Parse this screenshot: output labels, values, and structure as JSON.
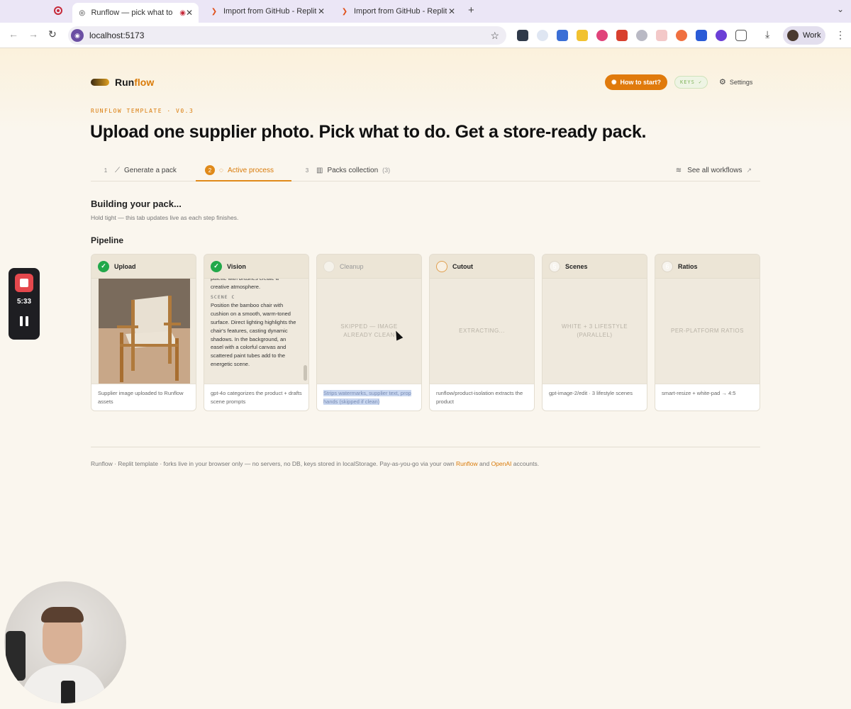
{
  "browser": {
    "tabs": [
      {
        "label": "Runflow — pick what to d",
        "active": true
      },
      {
        "label": "Import from GitHub - Replit",
        "active": false
      },
      {
        "label": "Import from GitHub - Replit",
        "active": false
      }
    ],
    "url": "localhost:5173",
    "profile_label": "Work"
  },
  "header": {
    "logo_run": "Run",
    "logo_flow": "flow",
    "how_to_label": "How to start?",
    "keys_label": "KEYS ✓",
    "settings_label": "Settings"
  },
  "hero": {
    "eyebrow": "RUNFLOW TEMPLATE · V0.3",
    "title": "Upload one supplier photo. Pick what to do. Get a store-ready pack."
  },
  "tabs": [
    {
      "num": "1",
      "label": "Generate a pack",
      "count": ""
    },
    {
      "num": "2",
      "label": "Active process",
      "count": ""
    },
    {
      "num": "3",
      "label": "Packs collection",
      "count": "(3)"
    }
  ],
  "see_all": "See all workflows",
  "building": {
    "title": "Building your pack...",
    "subtitle": "Hold tight — this tab updates live as each step finishes."
  },
  "pipeline": {
    "title": "Pipeline",
    "steps": [
      {
        "badge": "✓",
        "name": "Upload",
        "status": "",
        "footer": "Supplier image uploaded to Runflow assets"
      },
      {
        "badge": "✓",
        "name": "Vision",
        "status": "",
        "footer": "gpt-4o categorizes the product + drafts scene prompts",
        "vision_top": "palette with brushes create a creative atmosphere.",
        "vision_label": "SCENE C",
        "vision_body": "Position the bamboo chair with cushion on a smooth, warm-toned surface. Direct lighting highlights the chair's features, casting dynamic shadows. In the background, an easel with a colorful canvas and scattered paint tubes add to the energetic scene."
      },
      {
        "badge": "",
        "name": "Cleanup",
        "status": "SKIPPED — IMAGE ALREADY CLEAN",
        "footer": "Strips watermarks, supplier text, prop hands (skipped if clean)"
      },
      {
        "badge": "◌",
        "name": "Cutout",
        "status": "EXTRACTING...",
        "footer": "runflow/product-isolation extracts the product"
      },
      {
        "badge": "5",
        "name": "Scenes",
        "status": "WHITE + 3 LIFESTYLE (PARALLEL)",
        "footer": "gpt-image-2/edit · 3 lifestyle scenes"
      },
      {
        "badge": "6",
        "name": "Ratios",
        "status": "PER-PLATFORM RATIOS",
        "footer": "smart-resize + white-pad → 4:5"
      }
    ]
  },
  "footer": {
    "text_before": "Runflow · Replit template · forks live in your browser only — no servers, no DB, keys stored in localStorage. Pay-as-you-go via your own ",
    "link1": "Runflow",
    "text_mid": " and ",
    "link2": "OpenAI",
    "text_after": " accounts."
  },
  "recording": {
    "time": "5:33"
  },
  "colors": {
    "accent": "#e07a0c",
    "done": "#22a84a",
    "background": "#faf6ee"
  }
}
